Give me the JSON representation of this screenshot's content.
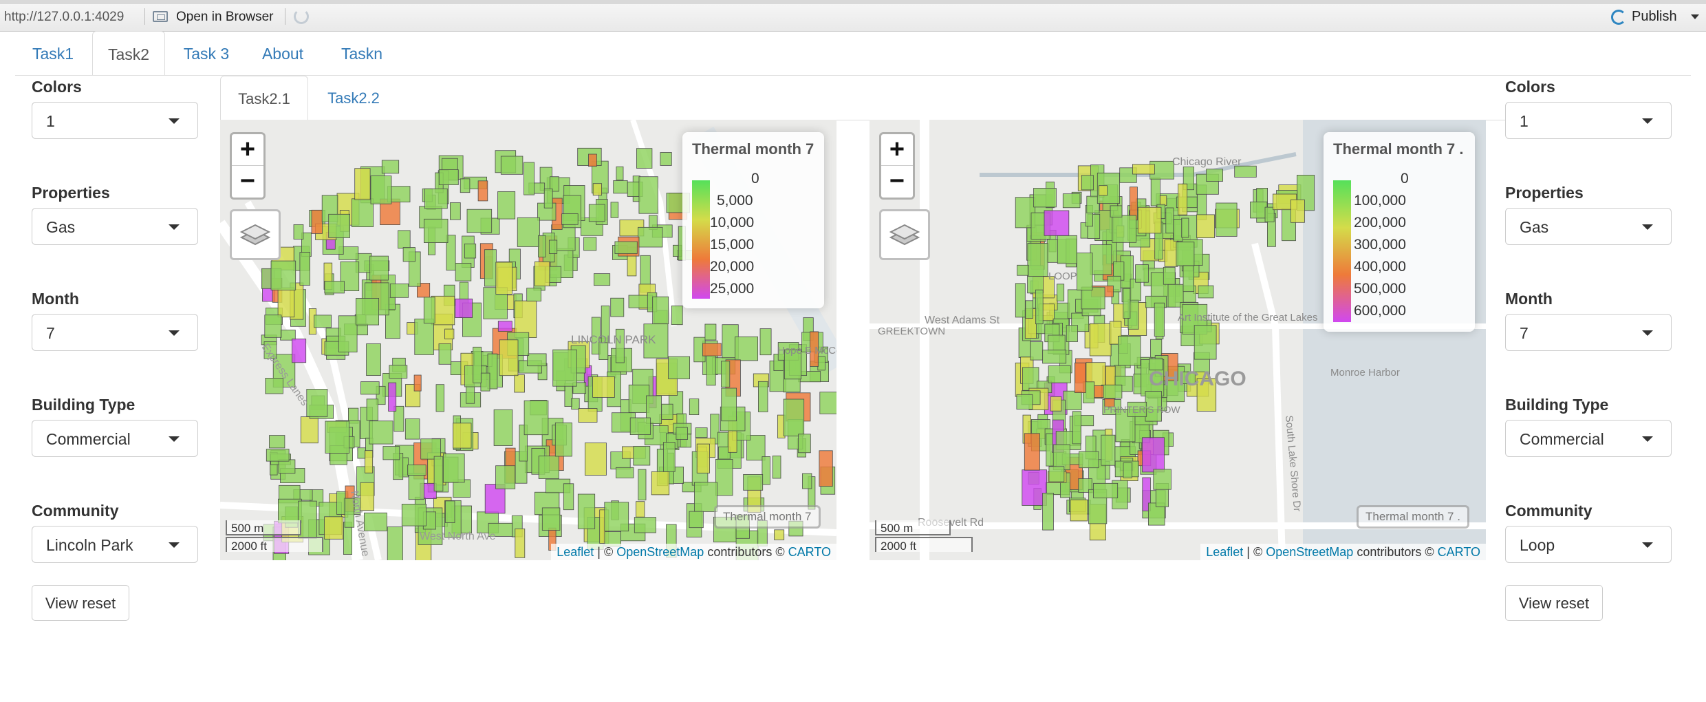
{
  "topbar": {
    "url": "http://127.0.0.1:4029",
    "open_in_browser": "Open in Browser",
    "publish": "Publish"
  },
  "tabs": [
    "Task1",
    "Task2",
    "Task 3",
    "About",
    "Taskn"
  ],
  "active_tab": "Task2",
  "subtabs": [
    "Task2.1",
    "Task2.2"
  ],
  "left_panel": {
    "colors_label": "Colors",
    "colors_value": "1",
    "properties_label": "Properties",
    "properties_value": "Gas",
    "month_label": "Month",
    "month_value": "7",
    "building_type_label": "Building Type",
    "building_type_value": "Commercial",
    "community_label": "Community",
    "community_value": "Lincoln Park",
    "reset_label": "View reset"
  },
  "right_panel": {
    "colors_label": "Colors",
    "colors_value": "1",
    "properties_label": "Properties",
    "properties_value": "Gas",
    "month_label": "Month",
    "month_value": "7",
    "building_type_label": "Building Type",
    "building_type_value": "Commercial",
    "community_label": "Community",
    "community_value": "Loop",
    "reset_label": "View reset"
  },
  "map_left": {
    "legend_title": "Thermal month 7",
    "legend_ticks": [
      "0",
      "5,000",
      "10,000",
      "15,000",
      "20,000",
      "25,000"
    ],
    "minimap_label": "Thermal month 7",
    "scale_m": "500 m",
    "scale_ft": "2000 ft",
    "place_labels": [
      "LINCOLN PARK",
      "Hope B McCormick Swan Pond",
      "Express Lanes",
      "North Avenue",
      "West North Ave"
    ]
  },
  "map_right": {
    "legend_title": "Thermal month 7 .",
    "legend_ticks": [
      "0",
      "100,000",
      "200,000",
      "300,000",
      "400,000",
      "500,000",
      "600,000"
    ],
    "minimap_label": "Thermal month 7 .",
    "scale_m": "500 m",
    "scale_ft": "2000 ft",
    "place_labels": [
      "West Adams St",
      "GREEKTOWN",
      "Art Institute of the Great Lakes",
      "CHICAGO",
      "Monroe Harbor",
      "PRINTER'S ROW",
      "Roosevelt Rd",
      "South Lake Shore Dr",
      "Chicago River",
      "LOOP"
    ]
  },
  "attribution": {
    "leaflet": "Leaflet",
    "sep": " | © ",
    "osm": "OpenStreetMap",
    "contrib": " contributors © ",
    "carto": "CARTO"
  },
  "colors": {
    "link": "#337ab7",
    "scale_low": "#55e05a",
    "scale_mid": "#d4dc4a",
    "scale_high": "#ee7a3a",
    "scale_max": "#d048f0",
    "building_fill": "#8fd35e"
  }
}
